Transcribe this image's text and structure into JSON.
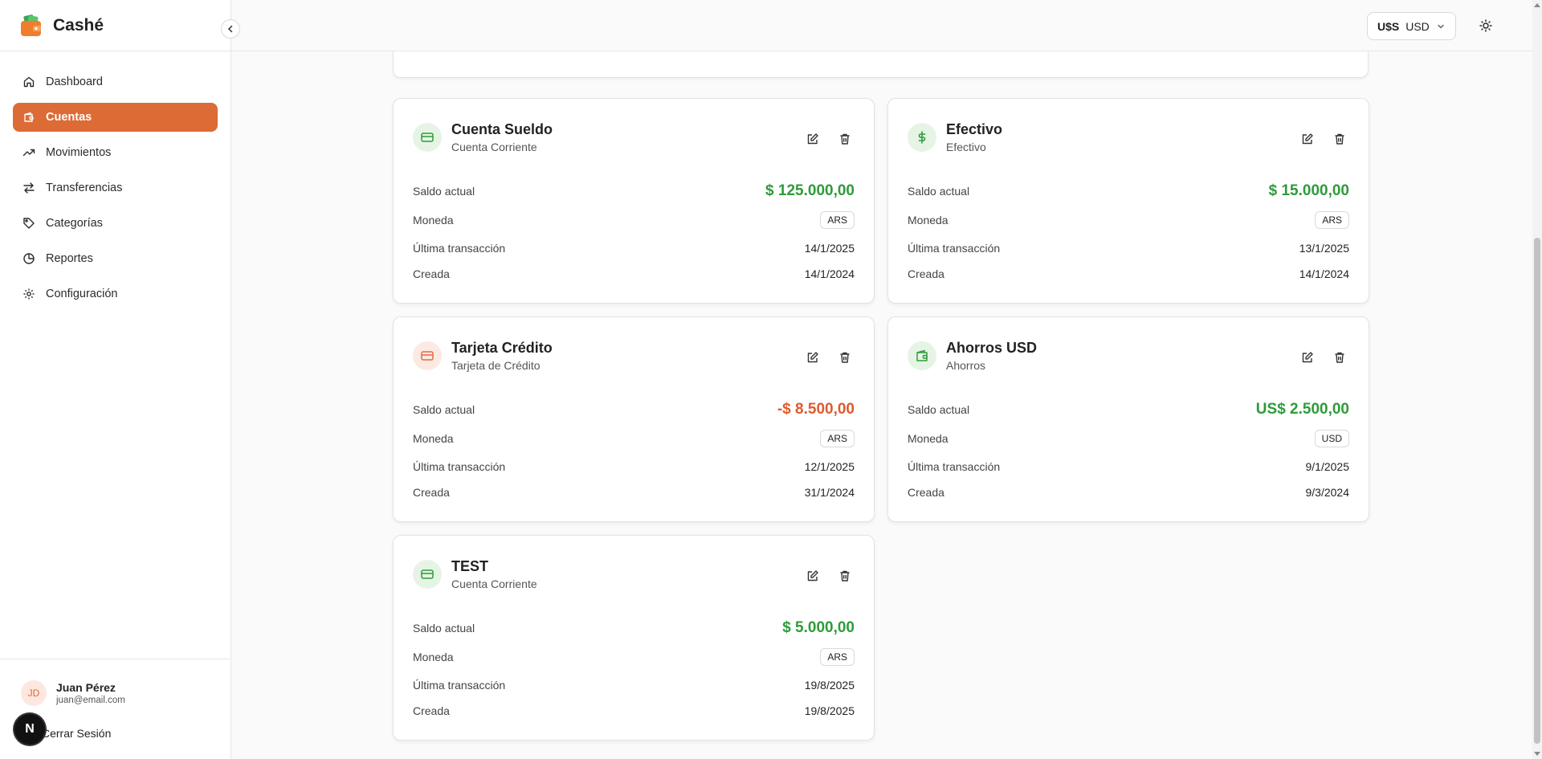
{
  "app": {
    "name": "Cashé"
  },
  "sidebar": {
    "items": [
      {
        "label": "Dashboard",
        "icon": "home-icon",
        "active": false
      },
      {
        "label": "Cuentas",
        "icon": "wallet-icon",
        "active": true
      },
      {
        "label": "Movimientos",
        "icon": "trending-up-icon",
        "active": false
      },
      {
        "label": "Transferencias",
        "icon": "arrows-exchange-icon",
        "active": false
      },
      {
        "label": "Categorías",
        "icon": "tag-icon",
        "active": false
      },
      {
        "label": "Reportes",
        "icon": "pie-chart-icon",
        "active": false
      },
      {
        "label": "Configuración",
        "icon": "gear-icon",
        "active": false
      }
    ],
    "user": {
      "initials": "JD",
      "name": "Juan Pérez",
      "email": "juan@email.com"
    },
    "logout_label": "Cerrar Sesión",
    "next_badge": "N"
  },
  "topbar": {
    "currency_symbol": "U$S",
    "currency_code": "USD"
  },
  "labels": {
    "balance": "Saldo actual",
    "currency": "Moneda",
    "last_tx": "Última transacción",
    "created": "Creada"
  },
  "accounts": [
    {
      "name": "Cuenta Sueldo",
      "type": "Cuenta Corriente",
      "balance": "$ 125.000,00",
      "balance_sign": "positive",
      "currency": "ARS",
      "last_tx": "14/1/2025",
      "created": "14/1/2024",
      "icon": "credit-card-icon"
    },
    {
      "name": "Efectivo",
      "type": "Efectivo",
      "balance": "$ 15.000,00",
      "balance_sign": "positive",
      "currency": "ARS",
      "last_tx": "13/1/2025",
      "created": "14/1/2024",
      "icon": "dollar-icon"
    },
    {
      "name": "Tarjeta Crédito",
      "type": "Tarjeta de Crédito",
      "balance": "-$ 8.500,00",
      "balance_sign": "negative",
      "currency": "ARS",
      "last_tx": "12/1/2025",
      "created": "31/1/2024",
      "icon": "credit-card-icon"
    },
    {
      "name": "Ahorros USD",
      "type": "Ahorros",
      "balance": "US$ 2.500,00",
      "balance_sign": "positive",
      "currency": "USD",
      "last_tx": "9/1/2025",
      "created": "9/3/2024",
      "icon": "wallet-icon"
    },
    {
      "name": "TEST",
      "type": "Cuenta Corriente",
      "balance": "$ 5.000,00",
      "balance_sign": "positive",
      "currency": "ARS",
      "last_tx": "19/8/2025",
      "created": "19/8/2025",
      "icon": "credit-card-icon"
    }
  ],
  "colors": {
    "accent": "#dd6b35",
    "positive": "#2e9b3a",
    "negative": "#dd5b2f"
  }
}
